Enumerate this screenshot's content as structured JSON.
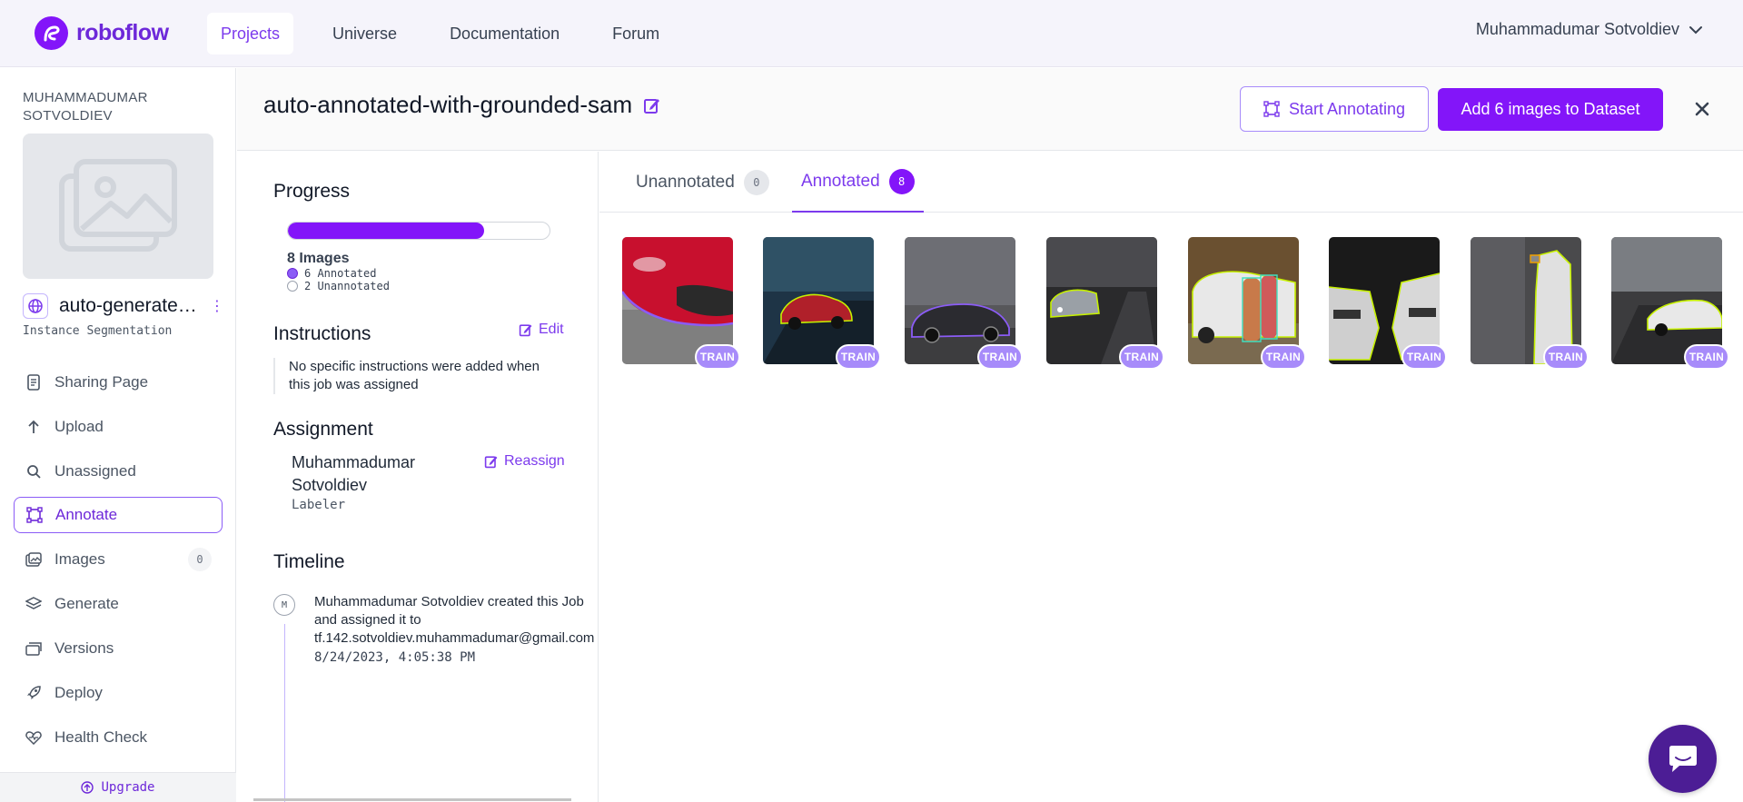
{
  "nav": {
    "brand": "roboflow",
    "links": [
      "Projects",
      "Universe",
      "Documentation",
      "Forum"
    ],
    "active_link": "Projects",
    "user_name": "Muhammadumar Sotvoldiev"
  },
  "sidebar": {
    "workspace_name": "MUHAMMADUMAR SOTVOLDIEV",
    "project_name": "auto-generate…",
    "project_type": "Instance Segmentation",
    "items": [
      {
        "label": "Sharing Page",
        "icon": "document-icon"
      },
      {
        "label": "Upload",
        "icon": "upload-arrow-icon"
      },
      {
        "label": "Unassigned",
        "icon": "search-icon"
      },
      {
        "label": "Annotate",
        "icon": "annotate-icon",
        "active": true
      },
      {
        "label": "Images",
        "icon": "images-icon",
        "count": "0"
      },
      {
        "label": "Generate",
        "icon": "layers-icon"
      },
      {
        "label": "Versions",
        "icon": "versions-icon"
      },
      {
        "label": "Deploy",
        "icon": "rocket-icon"
      },
      {
        "label": "Health Check",
        "icon": "heart-pulse-icon"
      }
    ],
    "upgrade_label": "Upgrade"
  },
  "header": {
    "title": "auto-annotated-with-grounded-sam",
    "start_annotating": "Start Annotating",
    "add_images": "Add 6 images to Dataset"
  },
  "panel": {
    "progress_title": "Progress",
    "progress_fraction": 0.75,
    "images_total": "8 Images",
    "annotated_label": "6 Annotated",
    "unannotated_label": "2 Unannotated",
    "instructions_title": "Instructions",
    "edit_label": "Edit",
    "instructions_text": "No specific instructions were added when this job was assigned",
    "assignment_title": "Assignment",
    "assignee_name": "Muhammadumar Sotvoldiev",
    "assignee_role": "Labeler",
    "reassign_label": "Reassign",
    "timeline_title": "Timeline",
    "timeline_avatar": "M",
    "timeline_text": "Muhammadumar Sotvoldiev created this Job\nand assigned it to\ntf.142.sotvoldiev.muhammadumar@gmail.com",
    "timeline_time": "8/24/2023, 4:05:38 PM"
  },
  "tabs": [
    {
      "label": "Unannotated",
      "count": "0"
    },
    {
      "label": "Annotated",
      "count": "8",
      "active": true
    }
  ],
  "grid": {
    "badge": "TRAIN",
    "images": [
      {
        "desc": "red car front close-up"
      },
      {
        "desc": "red car on road at dusk"
      },
      {
        "desc": "dark sedan on road"
      },
      {
        "desc": "silver car on road at night"
      },
      {
        "desc": "people at white SUV trunk"
      },
      {
        "desc": "two white cars facing each other"
      },
      {
        "desc": "white car side with mirror"
      },
      {
        "desc": "white car on highway"
      }
    ]
  },
  "colors": {
    "accent": "#8315f9",
    "accent_text": "#7c3aed",
    "mask_outline": "#c6f000"
  }
}
